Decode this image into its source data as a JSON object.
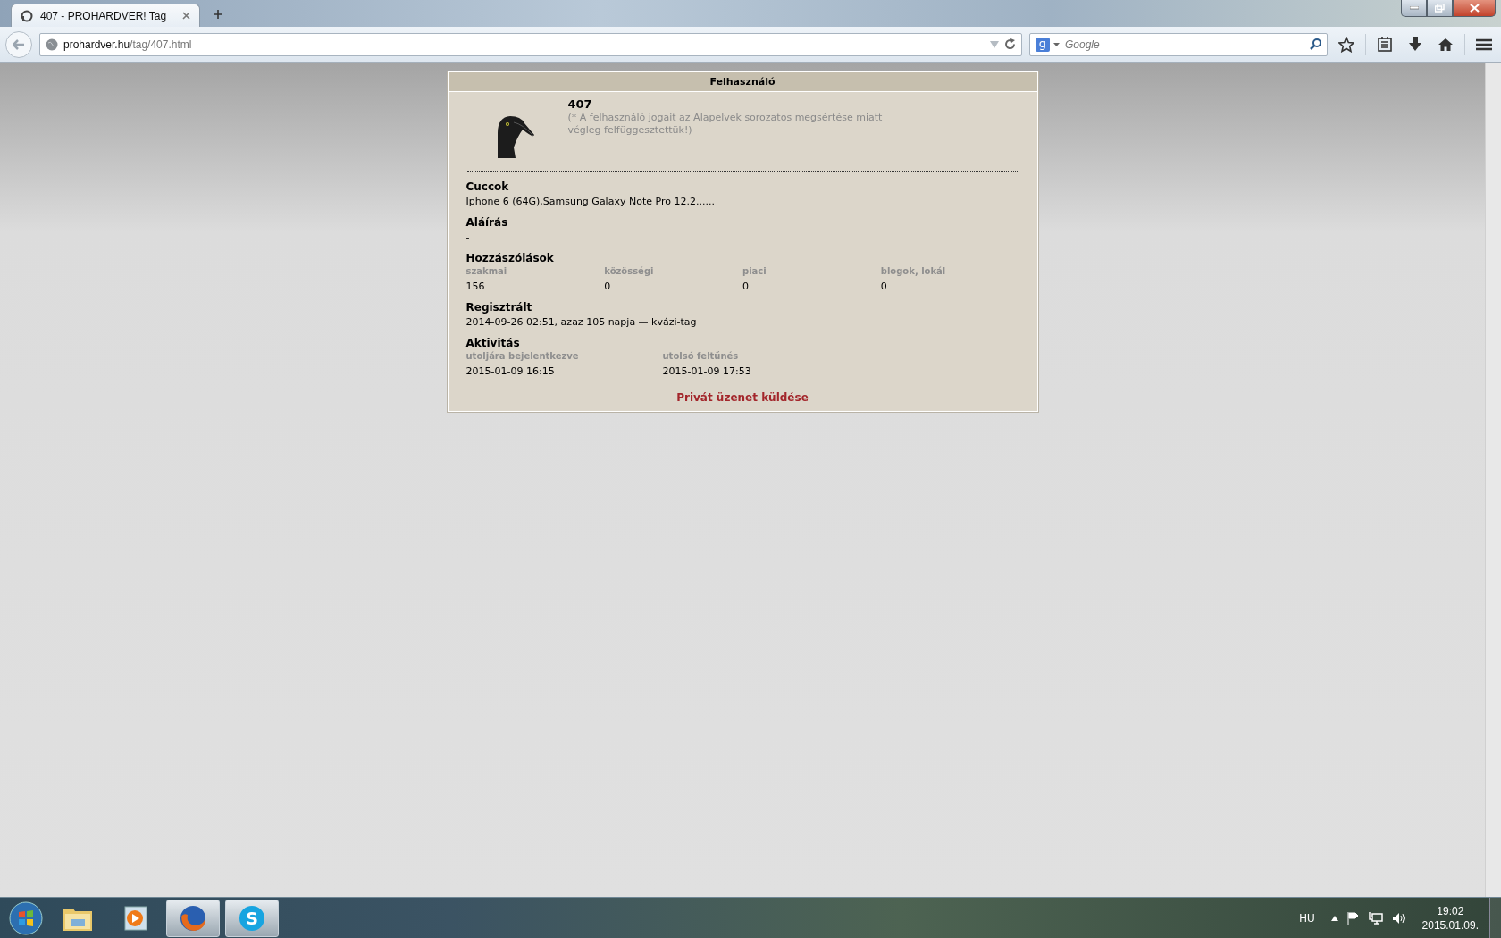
{
  "browser": {
    "tab": {
      "title": "407 - PROHARDVER! Tag",
      "selected": true
    },
    "url": "prohardver.hu/tag/407.html",
    "search": {
      "engine_badge": "g",
      "placeholder": "Google"
    }
  },
  "card": {
    "header": "Felhasználó",
    "name": "407",
    "note": "(* A felhasználó jogait az Alapelvek sorozatos megsértése miatt végleg felfüggesztettük!)",
    "sections": [
      {
        "kind": "text",
        "title": "Cuccok",
        "text": "Iphone 6 (64G),Samsung Galaxy Note Pro 12.2......"
      },
      {
        "kind": "text",
        "title": "Aláírás",
        "text": "-"
      },
      {
        "kind": "columns",
        "title": "Hozzászólások",
        "columns": [
          {
            "label": "szakmai",
            "value": "156"
          },
          {
            "label": "közösségi",
            "value": "0"
          },
          {
            "label": "piaci",
            "value": "0"
          },
          {
            "label": "blogok, lokál",
            "value": "0"
          }
        ]
      },
      {
        "kind": "text",
        "title": "Regisztrált",
        "text": "2014-09-26 02:51, azaz 105 napja — kvázi-tag"
      },
      {
        "kind": "columns",
        "title": "Aktivitás",
        "columns": [
          {
            "label": "utoljára bejelentkezve",
            "value": "2015-01-09 16:15"
          },
          {
            "label": "utolsó feltűnés",
            "value": "2015-01-09 17:53"
          }
        ]
      }
    ],
    "link": "Privát üzenet küldése"
  },
  "taskbar": {
    "skype_badge": "S",
    "language": "HU",
    "time": "19:02",
    "date": "2015.01.09."
  }
}
